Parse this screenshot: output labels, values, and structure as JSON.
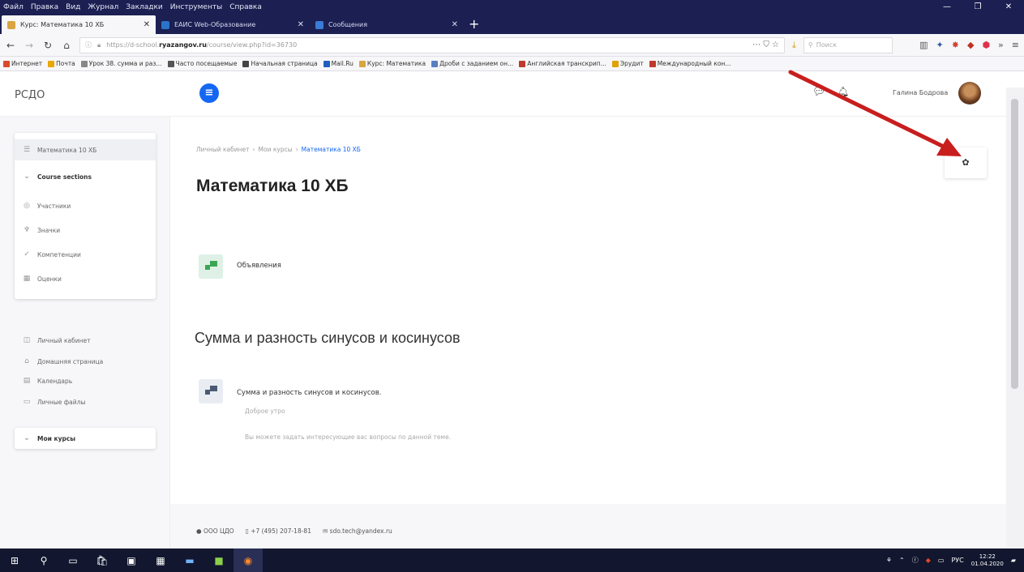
{
  "browser": {
    "menu": [
      "Файл",
      "Правка",
      "Вид",
      "Журнал",
      "Закладки",
      "Инструменты",
      "Справка"
    ],
    "window_controls": [
      "—",
      "❐",
      "✕"
    ],
    "tabs": [
      {
        "title": "Курс: Математика 10 ХБ",
        "close": "✕",
        "color": "#d9a441"
      },
      {
        "title": "ЕАИС Web-Образование",
        "close": "✕",
        "color": "#2b73c8"
      },
      {
        "title": "Сообщения",
        "close": "✕",
        "color": "#3a7bd5"
      }
    ],
    "new_tab": "+",
    "url_prefix": "https://d-school.",
    "url_domain": "ryazangov.ru",
    "url_path": "/course/view.php?id=36730",
    "url_actions": "⋯ ⛉ ☆",
    "search_placeholder": "Поиск",
    "bookmarks": [
      {
        "label": "Интернет",
        "color": "#d94a2a"
      },
      {
        "label": "Почта",
        "color": "#e8a800"
      },
      {
        "label": "Урок 38. сумма и раз...",
        "color": "#888"
      },
      {
        "label": "Часто посещаемые",
        "color": "#555"
      },
      {
        "label": "Начальная страница",
        "color": "#444"
      },
      {
        "label": "Mail.Ru",
        "color": "#1f5fbf"
      },
      {
        "label": "Курс: Математика",
        "color": "#d9a441"
      },
      {
        "label": "Дроби с заданием он...",
        "color": "#5a7fbf"
      },
      {
        "label": "Английская транскрип...",
        "color": "#c0392b"
      },
      {
        "label": "Эрудит",
        "color": "#e0a000"
      },
      {
        "label": "Международный кон...",
        "color": "#c0392b"
      }
    ]
  },
  "header": {
    "brand": "РСДО",
    "drawer_icon": "≡",
    "user_name": "Галина Бодрова"
  },
  "sidebar": {
    "course_items": [
      {
        "label": "Математика 10 ХБ",
        "icon": "☰",
        "highlight": true
      },
      {
        "label": "Course sections",
        "icon": "⌄",
        "bold": true
      },
      {
        "label": "Участники",
        "icon": "◎"
      },
      {
        "label": "Значки",
        "icon": "♆"
      },
      {
        "label": "Компетенции",
        "icon": "✓"
      },
      {
        "label": "Оценки",
        "icon": "▦"
      }
    ],
    "nav_items": [
      {
        "label": "Личный кабинет",
        "icon": "◫"
      },
      {
        "label": "Домашняя страница",
        "icon": "⌂"
      },
      {
        "label": "Календарь",
        "icon": "▤"
      },
      {
        "label": "Личные файлы",
        "icon": "▭"
      }
    ],
    "my_courses": {
      "label": "Мои курсы",
      "icon": "⌄"
    }
  },
  "main": {
    "breadcrumb": [
      "Личный кабинет",
      "Мои курсы",
      "Математика 10 ХБ"
    ],
    "breadcrumb_sep": "›",
    "course_title": "Математика 10 ХБ",
    "settings_icon": "✿",
    "announcements": "Объявления",
    "section_title": "Сумма и разность синусов и косинусов",
    "forum_title": "Сумма и разность синусов и косинусов.",
    "forum_greeting": "Доброе утро",
    "forum_desc": "Вы можете задать интересующие вас вопросы по данной теме."
  },
  "footer": {
    "org": "ООО ЦДО",
    "phone": "+7 (495) 207-18-81",
    "email": "sdo.tech@yandex.ru"
  },
  "taskbar": {
    "lang": "РУС",
    "time": "12:22",
    "date": "01.04.2020"
  },
  "colors": {
    "accent": "#1467f2",
    "annotation_arrow": "#c81e1e"
  }
}
